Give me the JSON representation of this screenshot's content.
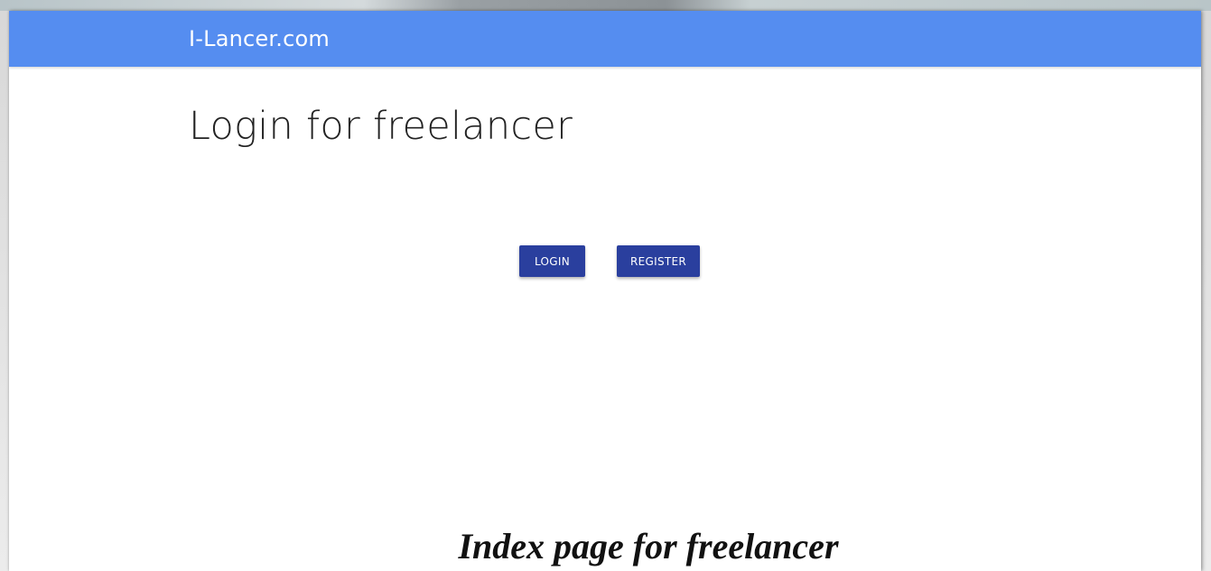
{
  "app": {
    "brand": "I-Lancer.com"
  },
  "main": {
    "title": "Login for freelancer",
    "login_label": "LOGIN",
    "register_label": "REGISTER"
  },
  "caption": "Index page for freelancer",
  "colors": {
    "appbar": "#558df0",
    "button": "#2a3f9e",
    "background": "#ffffff"
  }
}
